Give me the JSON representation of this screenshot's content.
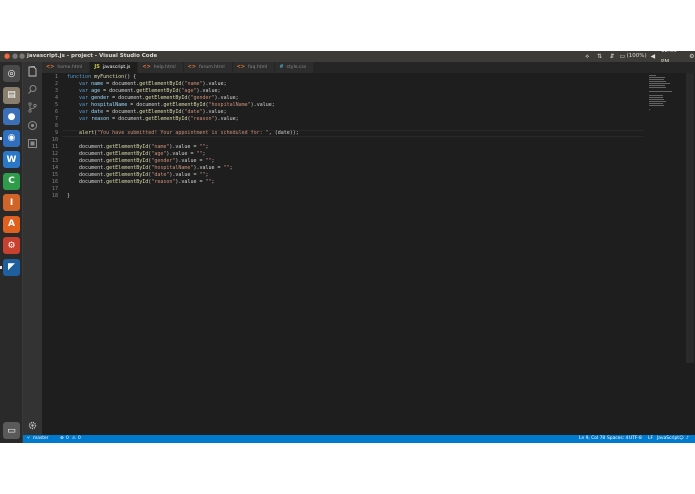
{
  "window": {
    "title": "javascript.js - project - Visual Studio Code"
  },
  "tray": {
    "battery": "(100%)",
    "clock": "12:03 PM"
  },
  "tabs": [
    {
      "label": "home.html",
      "icon": "<>",
      "color": "#e37933",
      "active": false
    },
    {
      "label": "javascript.js",
      "icon": "JS",
      "color": "#cbcb41",
      "active": true
    },
    {
      "label": "help.html",
      "icon": "<>",
      "color": "#e37933",
      "active": false
    },
    {
      "label": "forum.html",
      "icon": "<>",
      "color": "#e37933",
      "active": false
    },
    {
      "label": "faq.html",
      "icon": "<>",
      "color": "#e37933",
      "active": false
    },
    {
      "label": "style.css",
      "icon": "#",
      "color": "#519aba",
      "active": false
    }
  ],
  "editor": {
    "current_line": 9,
    "lines": [
      [
        [
          "kw",
          "function "
        ],
        [
          "fn",
          "myFunction"
        ],
        [
          "t",
          "() {"
        ]
      ],
      [
        [
          "t",
          "    "
        ],
        [
          "kw",
          "var "
        ],
        [
          "var",
          "name"
        ],
        [
          "t",
          " = document."
        ],
        [
          "fn",
          "getElementById"
        ],
        [
          "t",
          "("
        ],
        [
          "str",
          "\"name\""
        ],
        [
          "t",
          ").value;"
        ]
      ],
      [
        [
          "t",
          "    "
        ],
        [
          "kw",
          "var "
        ],
        [
          "var",
          "age"
        ],
        [
          "t",
          " = document."
        ],
        [
          "fn",
          "getElementById"
        ],
        [
          "t",
          "("
        ],
        [
          "str",
          "\"age\""
        ],
        [
          "t",
          ").value;"
        ]
      ],
      [
        [
          "t",
          "    "
        ],
        [
          "kw",
          "var "
        ],
        [
          "var",
          "gender"
        ],
        [
          "t",
          " = document."
        ],
        [
          "fn",
          "getElementById"
        ],
        [
          "t",
          "("
        ],
        [
          "str",
          "\"gender\""
        ],
        [
          "t",
          ").value;"
        ]
      ],
      [
        [
          "t",
          "    "
        ],
        [
          "kw",
          "var "
        ],
        [
          "var",
          "hospitalName"
        ],
        [
          "t",
          " = document."
        ],
        [
          "fn",
          "getElementById"
        ],
        [
          "t",
          "("
        ],
        [
          "str",
          "\"hospitalName\""
        ],
        [
          "t",
          ").value;"
        ]
      ],
      [
        [
          "t",
          "    "
        ],
        [
          "kw",
          "var "
        ],
        [
          "var",
          "date"
        ],
        [
          "t",
          " = document."
        ],
        [
          "fn",
          "getElementById"
        ],
        [
          "t",
          "("
        ],
        [
          "str",
          "\"date\""
        ],
        [
          "t",
          ").value;"
        ]
      ],
      [
        [
          "t",
          "    "
        ],
        [
          "kw",
          "var "
        ],
        [
          "var",
          "reason"
        ],
        [
          "t",
          " = document."
        ],
        [
          "fn",
          "getElementById"
        ],
        [
          "t",
          "("
        ],
        [
          "str",
          "\"reason\""
        ],
        [
          "t",
          ").value;"
        ]
      ],
      [],
      [
        [
          "t",
          "    "
        ],
        [
          "fn",
          "alert"
        ],
        [
          "t",
          "("
        ],
        [
          "str",
          "\"You have submitted! Your appointment is scheduled for: \""
        ],
        [
          "t",
          ", (date));"
        ]
      ],
      [],
      [
        [
          "t",
          "    document."
        ],
        [
          "fn",
          "getElementById"
        ],
        [
          "t",
          "("
        ],
        [
          "str",
          "\"name\""
        ],
        [
          "t",
          ").value = "
        ],
        [
          "str",
          "\"\""
        ],
        [
          "t",
          ";"
        ]
      ],
      [
        [
          "t",
          "    document."
        ],
        [
          "fn",
          "getElementById"
        ],
        [
          "t",
          "("
        ],
        [
          "str",
          "\"age\""
        ],
        [
          "t",
          ").value = "
        ],
        [
          "str",
          "\"\""
        ],
        [
          "t",
          ";"
        ]
      ],
      [
        [
          "t",
          "    document."
        ],
        [
          "fn",
          "getElementById"
        ],
        [
          "t",
          "("
        ],
        [
          "str",
          "\"gender\""
        ],
        [
          "t",
          ").value = "
        ],
        [
          "str",
          "\"\""
        ],
        [
          "t",
          ";"
        ]
      ],
      [
        [
          "t",
          "    document."
        ],
        [
          "fn",
          "getElementById"
        ],
        [
          "t",
          "("
        ],
        [
          "str",
          "\"hospitalName\""
        ],
        [
          "t",
          ").value = "
        ],
        [
          "str",
          "\"\""
        ],
        [
          "t",
          ";"
        ]
      ],
      [
        [
          "t",
          "    document."
        ],
        [
          "fn",
          "getElementById"
        ],
        [
          "t",
          "("
        ],
        [
          "str",
          "\"date\""
        ],
        [
          "t",
          ").value = "
        ],
        [
          "str",
          "\"\""
        ],
        [
          "t",
          ";"
        ]
      ],
      [
        [
          "t",
          "    document."
        ],
        [
          "fn",
          "getElementById"
        ],
        [
          "t",
          "("
        ],
        [
          "str",
          "\"reason\""
        ],
        [
          "t",
          ").value = "
        ],
        [
          "str",
          "\"\""
        ],
        [
          "t",
          ";"
        ]
      ],
      [],
      [
        [
          "t",
          "}"
        ]
      ]
    ]
  },
  "launcher": [
    {
      "name": "dash-home-icon",
      "glyph": "◎",
      "color": "#4a4a4a",
      "running": false
    },
    {
      "name": "files-icon",
      "glyph": "▤",
      "color": "#8a7f6e",
      "running": false
    },
    {
      "name": "firefox-icon",
      "glyph": "●",
      "color": "#3b6fb6",
      "running": false
    },
    {
      "name": "chrome-icon",
      "glyph": "◉",
      "color": "#2f6fbd",
      "running": true
    },
    {
      "name": "writer-icon",
      "glyph": "W",
      "color": "#2a78c7",
      "running": false
    },
    {
      "name": "calc-icon",
      "glyph": "C",
      "color": "#2e9c4a",
      "running": false
    },
    {
      "name": "impress-icon",
      "glyph": "I",
      "color": "#d0652a",
      "running": false
    },
    {
      "name": "software-center-icon",
      "glyph": "A",
      "color": "#e0601f",
      "running": false
    },
    {
      "name": "system-settings-icon",
      "glyph": "⚙",
      "color": "#c8402e",
      "running": false
    },
    {
      "name": "vscode-icon",
      "glyph": "◤",
      "color": "#1f5f9e",
      "running": true
    },
    {
      "name": "trash-icon",
      "glyph": "▭",
      "color": "#5a5a5a",
      "running": false
    }
  ],
  "statusbar": {
    "branch": "master",
    "errors": "0",
    "warnings": "0",
    "position": "Ln 9, Col 78",
    "spaces": "Spaces: 4",
    "encoding": "UTF-8",
    "eol": "LF",
    "language": "JavaScript"
  },
  "colors": {
    "accent": "#007acc",
    "editor_bg": "#1e1e1e",
    "keyword": "#569cd6",
    "function": "#dcdcaa",
    "string": "#ce9178"
  }
}
